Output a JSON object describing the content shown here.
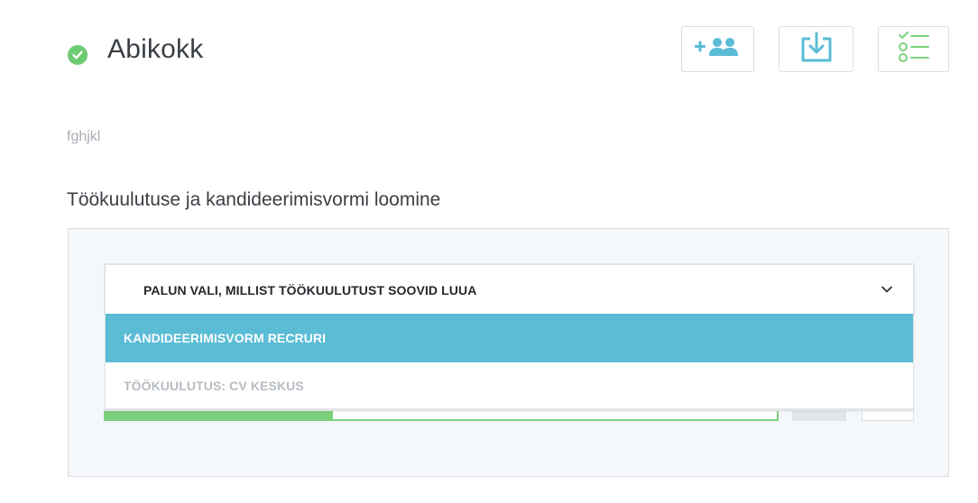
{
  "header": {
    "title": "Abikokk",
    "status_icon": "check-circle-icon",
    "status_color": "#6dcb73"
  },
  "toolbar": {
    "buttons": [
      {
        "name": "add-users-button",
        "icon": "add-users-icon"
      },
      {
        "name": "download-button",
        "icon": "download-icon"
      },
      {
        "name": "checklist-button",
        "icon": "checklist-icon"
      }
    ],
    "icon_color": "#5bbcd6",
    "checklist_icon_color": "#7dd17c"
  },
  "description": "fghjkl",
  "section": {
    "title": "Töökuulutuse ja kandideerimisvormi loomine"
  },
  "dropdown": {
    "placeholder": "PALUN VALI, MILLIST TÖÖKUULUTUST SOOVID LUUA",
    "options": [
      {
        "label": "KANDIDEERIMISVORM RECRURI",
        "highlighted": true
      },
      {
        "label": "TÖÖKUULUTUS: CV KESKUS",
        "highlighted": false
      }
    ],
    "highlight_color": "#5bbcd6"
  },
  "progress": {
    "fraction": 0.34,
    "color": "#7dd17c"
  }
}
